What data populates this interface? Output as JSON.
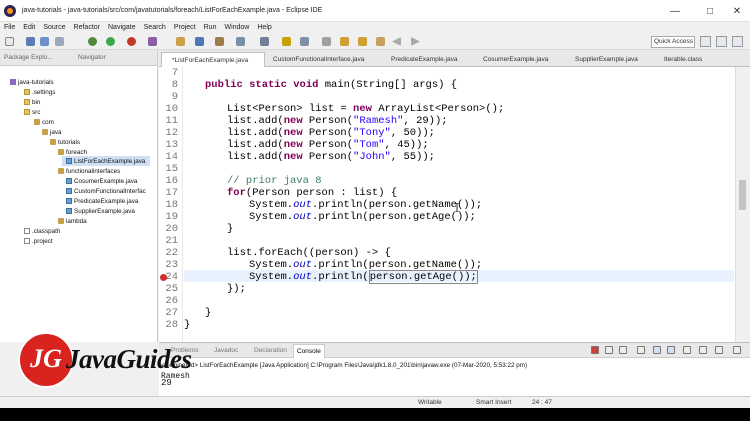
{
  "window": {
    "title": "java-tutorials - java-tutorials/src/com/javatutorials/foreach/ListForEachExample.java - Eclipse IDE",
    "min": "—",
    "max": "□",
    "close": "✕"
  },
  "menu": [
    "File",
    "Edit",
    "Source",
    "Refactor",
    "Navigate",
    "Search",
    "Project",
    "Run",
    "Window",
    "Help"
  ],
  "quick_access": "Quick Access",
  "left_tabs": [
    "Package Explo...",
    "Navigator"
  ],
  "tree": [
    {
      "label": "java-tutorials",
      "icon": "project-icon"
    },
    {
      "label": ".settings",
      "icon": "folder-icon"
    },
    {
      "label": "bin",
      "icon": "folder-icon"
    },
    {
      "label": "src",
      "icon": "folder-icon"
    },
    {
      "label": "com",
      "icon": "package-icon"
    },
    {
      "label": "java",
      "icon": "package-icon"
    },
    {
      "label": "tutorials",
      "icon": "package-icon"
    },
    {
      "label": "foreach",
      "icon": "package-icon"
    },
    {
      "label": "ListForEachExample.java",
      "icon": "java-file-icon"
    },
    {
      "label": "functionalinterfaces",
      "icon": "package-icon"
    },
    {
      "label": "CosumerExample.java",
      "icon": "java-file-icon"
    },
    {
      "label": "CustomFunctionalInterfac",
      "icon": "java-file-icon"
    },
    {
      "label": "PredicateExample.java",
      "icon": "java-file-icon"
    },
    {
      "label": "SupplierExample.java",
      "icon": "java-file-icon"
    },
    {
      "label": "lambda",
      "icon": "package-icon"
    },
    {
      "label": ".classpath",
      "icon": "file-icon"
    },
    {
      "label": ".project",
      "icon": "file-icon"
    }
  ],
  "editor_tabs": [
    "*ListForEachExample.java",
    "CustomFunctionalInterface.java",
    "PredicateExample.java",
    "CosumerExample.java",
    "SupplierExample.java",
    "Iterable.class"
  ],
  "line_numbers": [
    "7",
    "8",
    "9",
    "10",
    "11",
    "12",
    "13",
    "14",
    "15",
    "16",
    "17",
    "18",
    "19",
    "20",
    "21",
    "22",
    "23",
    "24",
    "25",
    "26",
    "27",
    "28"
  ],
  "code": {
    "l8": [
      "public static void ",
      "main(String[] args) {"
    ],
    "l10": [
      "List<Person> list = ",
      "new",
      " ArrayList<Person>();"
    ],
    "l11": [
      "list.add(",
      "new",
      " Person(",
      "\"Ramesh\"",
      ", 29));"
    ],
    "l12": [
      "list.add(",
      "new",
      " Person(",
      "\"Tony\"",
      ", 50));"
    ],
    "l13": [
      "list.add(",
      "new",
      " Person(",
      "\"Tom\"",
      ", 45));"
    ],
    "l14": [
      "list.add(",
      "new",
      " Person(",
      "\"John\"",
      ", 55));"
    ],
    "l16": "// prior java 8",
    "l17": [
      "for",
      "(Person person : list) {"
    ],
    "l18": [
      "System.",
      "out",
      ".println(person.getName());"
    ],
    "l19": [
      "System.",
      "out",
      ".println(person.getAge());"
    ],
    "l20": "}",
    "l22": "list.forEach((person) -> {",
    "l23": [
      "System.",
      "out",
      ".println(person.getName());"
    ],
    "l24": [
      "System.",
      "out",
      ".println(",
      "person.getAge());"
    ],
    "l25": "});",
    "l27": "}",
    "l28": "}"
  },
  "bottom_tabs": [
    "Problems",
    "Javadoc",
    "Declaration",
    "Console"
  ],
  "console": {
    "terminated": "<terminated> ListForEachExample [Java Application] C:\\Program Files\\Java\\jdk1.8.0_201\\bin\\javaw.exe (07-Mar-2020, 5:53:22 pm)",
    "line1": "Ramesh",
    "line2": "29"
  },
  "status": {
    "writable": "Writable",
    "insert": "Smart Insert",
    "position": "24 : 47"
  },
  "logo": {
    "mono": "JG",
    "word": "JavaGuides"
  },
  "colors": {
    "keyword": "#7f0055",
    "string": "#2a00ff",
    "comment": "#3f7f5f",
    "field": "#0000c0",
    "logo_red": "#d8231f"
  }
}
